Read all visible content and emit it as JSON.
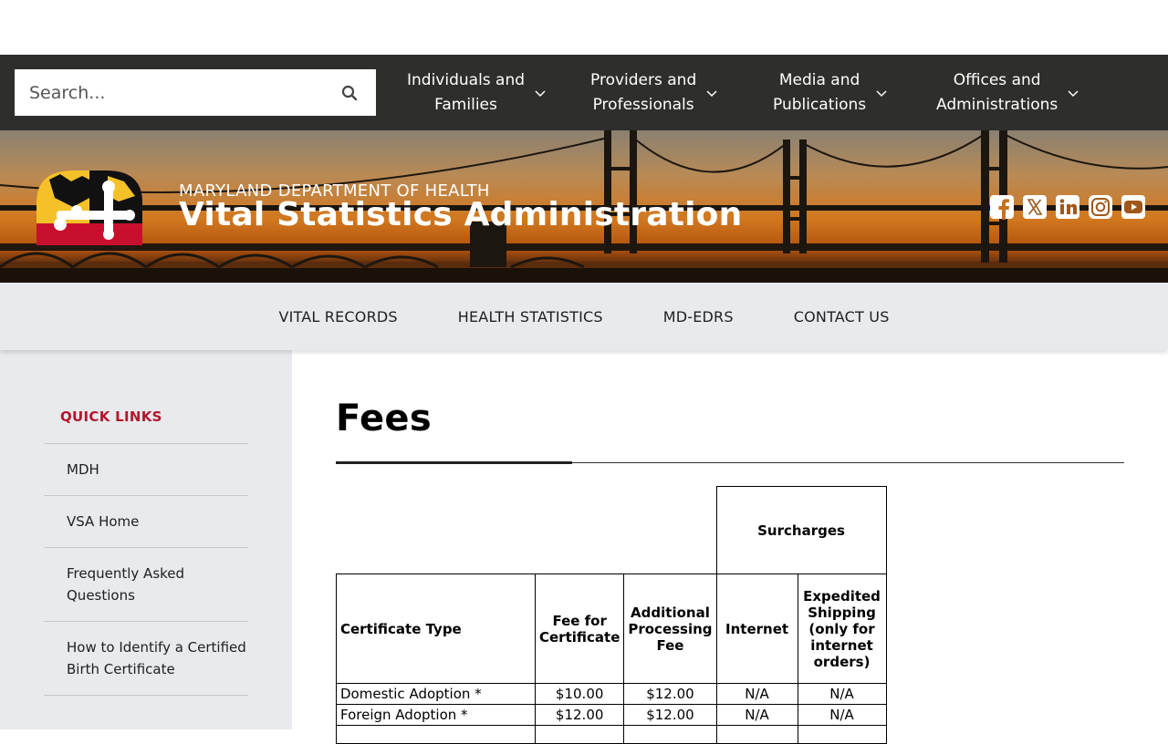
{
  "search": {
    "placeholder": "Search..."
  },
  "topnav": [
    {
      "line1": "Individuals and",
      "line2": "Families"
    },
    {
      "line1": "Providers and",
      "line2": "Professionals"
    },
    {
      "line1": "Media and",
      "line2": "Publications"
    },
    {
      "line1": "Offices and",
      "line2": "Administrations"
    }
  ],
  "banner": {
    "department": "MARYLAND DEPARTMENT OF HEALTH",
    "agency": "Vital Statistics Administration"
  },
  "social_icons": [
    "facebook-icon",
    "x-icon",
    "linkedin-icon",
    "instagram-icon",
    "youtube-icon"
  ],
  "subnav": [
    "VITAL RECORDS",
    "HEALTH STATISTICS",
    "MD-EDRS",
    "CONTACT US"
  ],
  "sidebar": {
    "title": "QUICK LINKS",
    "items": [
      "MDH",
      "VSA Home",
      "Frequently Asked Questions",
      "How to Identify a Certified Birth Certificate"
    ]
  },
  "page": {
    "title": "Fees"
  },
  "fees_table": {
    "group_header": "Surcharges",
    "headers": [
      "Certificate Type",
      "Fee for Certificate",
      "Additional Processing Fee",
      "Internet",
      "Expedited Shipping (only for internet orders)"
    ],
    "rows": [
      [
        "Domestic Adoption *",
        "$10.00",
        "$12.00",
        "N/A",
        "N/A"
      ],
      [
        "Foreign Adoption *",
        "$12.00",
        "$12.00",
        "N/A",
        "N/A"
      ]
    ]
  },
  "colors": {
    "topbar": "#2e2e2c",
    "accent_red": "#b5152b",
    "light_gray": "#e8eaed"
  }
}
